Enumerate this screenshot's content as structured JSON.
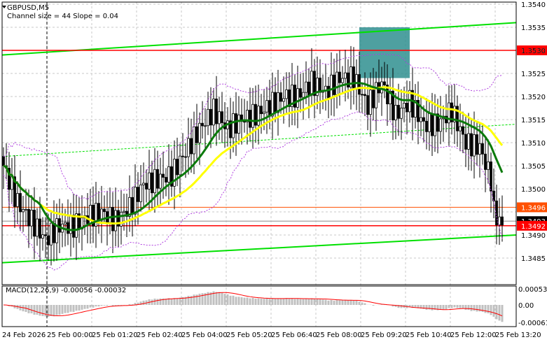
{
  "chart_data": {
    "type": "candlestick",
    "symbol": "GBPUSD,M5",
    "indicator_label": "Channel size = 44 Slope = 0.04",
    "macd_label": "MACD(12,26,9) -0.00056 -0.00032",
    "ylim": [
      1.3481,
      1.3541
    ],
    "y_ticks": [
      "1.3540",
      "1.3535",
      "1.3530",
      "1.3525",
      "1.3520",
      "1.3515",
      "1.3510",
      "1.3505",
      "1.3500",
      "1.3495",
      "1.3490",
      "1.3485"
    ],
    "macd_ticks": [
      "0.00053",
      "0.00",
      "-0.00061"
    ],
    "x_ticks": [
      "24 Feb 2026",
      "25 Feb 00:00",
      "25 Feb 01:20",
      "25 Feb 02:40",
      "25 Feb 04:00",
      "25 Feb 05:20",
      "25 Feb 06:40",
      "25 Feb 08:00",
      "25 Feb 09:20",
      "25 Feb 10:40",
      "25 Feb 12:00",
      "25 Feb 13:20"
    ],
    "close_waypoints": [
      [
        0,
        1.3505
      ],
      [
        5,
        1.3497
      ],
      [
        10,
        1.3493
      ],
      [
        15,
        1.3489
      ],
      [
        20,
        1.3492
      ],
      [
        25,
        1.3492
      ],
      [
        30,
        1.3494
      ],
      [
        35,
        1.3495
      ],
      [
        40,
        1.3493
      ],
      [
        45,
        1.3496
      ],
      [
        50,
        1.3501
      ],
      [
        55,
        1.3502
      ],
      [
        60,
        1.3503
      ],
      [
        65,
        1.3508
      ],
      [
        70,
        1.3513
      ],
      [
        75,
        1.3517
      ],
      [
        80,
        1.3513
      ],
      [
        85,
        1.3515
      ],
      [
        90,
        1.3516
      ],
      [
        95,
        1.3518
      ],
      [
        100,
        1.352
      ],
      [
        105,
        1.352
      ],
      [
        110,
        1.3523
      ],
      [
        115,
        1.3521
      ],
      [
        120,
        1.3524
      ],
      [
        125,
        1.3524
      ],
      [
        130,
        1.3518
      ],
      [
        135,
        1.3523
      ],
      [
        140,
        1.3516
      ],
      [
        145,
        1.3519
      ],
      [
        150,
        1.3514
      ],
      [
        155,
        1.3514
      ],
      [
        160,
        1.3517
      ],
      [
        165,
        1.351
      ],
      [
        170,
        1.3509
      ],
      [
        174,
        1.3502
      ],
      [
        175,
        1.3495
      ],
      [
        178,
        1.3492
      ]
    ],
    "levels": [
      {
        "price": 1.353,
        "label": "1.3530",
        "color": "#ff0000"
      },
      {
        "price": 1.3496,
        "label": "1.3496",
        "color": "#ff5000"
      },
      {
        "price": 1.3493,
        "label": "1.3493",
        "color": "#000000"
      },
      {
        "price": 1.3492,
        "label": "1.3492",
        "color": "#ff0000"
      }
    ],
    "channel": {
      "upper": [
        1.3529,
        1.3536
      ],
      "middle": [
        1.3507,
        1.3514
      ],
      "lower": [
        1.3484,
        1.349
      ],
      "color": "#00e000"
    },
    "zone": {
      "from_index": 127,
      "to_index": 145,
      "high": 1.3535,
      "low": 1.3524,
      "color": "#2f8f8f"
    },
    "ma_fast": {
      "period": 14,
      "color": "#0a7a0a"
    },
    "ma_slow": {
      "period": 30,
      "color": "#ffff00"
    }
  }
}
